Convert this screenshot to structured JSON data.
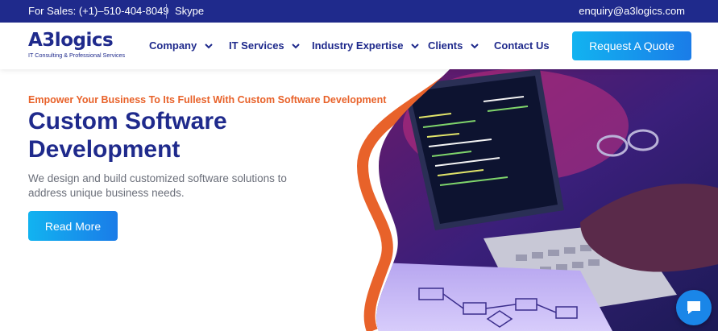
{
  "topbar": {
    "sales": "For Sales: (+1)–510-404-8049",
    "skype": "Skype",
    "email": "enquiry@a3logics.com"
  },
  "logo": {
    "name": "A3logics",
    "tagline": "IT Consulting & Professional Services"
  },
  "nav": {
    "items": [
      {
        "label": "Company"
      },
      {
        "label": "IT Services"
      },
      {
        "label": "Industry Expertise"
      },
      {
        "label": "Clients"
      },
      {
        "label": "Contact Us"
      }
    ],
    "cta": "Request A Quote"
  },
  "hero": {
    "tagline": "Empower Your Business To Its Fullest With Custom Software Development",
    "title": "Custom Software Development",
    "description": "We design and build customized software solutions to address unique business needs.",
    "button": "Read More"
  },
  "colors": {
    "brand": "#1f2a8c",
    "accent": "#e8622a",
    "cta": "#1a86e8"
  },
  "icons": [
    "chevron-down-icon",
    "chat-icon"
  ]
}
